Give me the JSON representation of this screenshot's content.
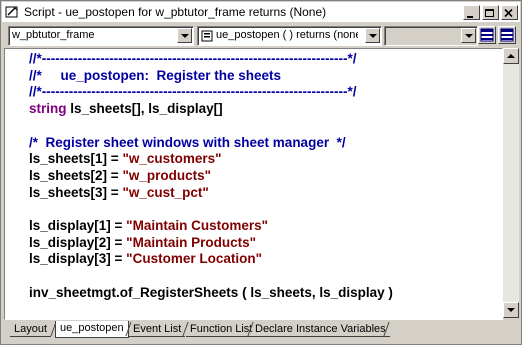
{
  "window": {
    "title": "Script - ue_postopen for w_pbtutor_frame returns (None)"
  },
  "toolbar": {
    "object_combo": "w_pbtutor_frame",
    "event_combo": "ue_postopen ( ) returns (none",
    "third_combo": ""
  },
  "code_lines": [
    [
      {
        "t": "//*--------------------------------------------------------------------*/",
        "c": "cm"
      }
    ],
    [
      {
        "t": "//*     ue_postopen:  Register the sheets",
        "c": "cm"
      }
    ],
    [
      {
        "t": "//*--------------------------------------------------------------------*/",
        "c": "cm"
      }
    ],
    [
      {
        "t": "string",
        "c": "kw"
      },
      {
        "t": " ls_sheets[], ls_display[]",
        "c": "tx"
      }
    ],
    [
      {
        "t": "",
        "c": "tx"
      }
    ],
    [
      {
        "t": "/*  Register sheet windows with sheet manager  */",
        "c": "cm"
      }
    ],
    [
      {
        "t": "ls_sheets[1] = ",
        "c": "tx"
      },
      {
        "t": "\"w_customers\"",
        "c": "st"
      }
    ],
    [
      {
        "t": "ls_sheets[2] = ",
        "c": "tx"
      },
      {
        "t": "\"w_products\"",
        "c": "st"
      }
    ],
    [
      {
        "t": "ls_sheets[3] = ",
        "c": "tx"
      },
      {
        "t": "\"w_cust_pct\"",
        "c": "st"
      }
    ],
    [
      {
        "t": "",
        "c": "tx"
      }
    ],
    [
      {
        "t": "ls_display[1] = ",
        "c": "tx"
      },
      {
        "t": "\"Maintain Customers\"",
        "c": "st"
      }
    ],
    [
      {
        "t": "ls_display[2] = ",
        "c": "tx"
      },
      {
        "t": "\"Maintain Products\"",
        "c": "st"
      }
    ],
    [
      {
        "t": "ls_display[3] = ",
        "c": "tx"
      },
      {
        "t": "\"Customer Location\"",
        "c": "st"
      }
    ],
    [
      {
        "t": "",
        "c": "tx"
      }
    ],
    [
      {
        "t": "inv_sheetmgt.of_RegisterSheets ( ls_sheets, ls_display )",
        "c": "tx"
      }
    ]
  ],
  "tabs": [
    {
      "label": "Layout",
      "active": false
    },
    {
      "label": "ue_postopen",
      "active": true
    },
    {
      "label": "Event List",
      "active": false
    },
    {
      "label": "Function List",
      "active": false
    },
    {
      "label": "Declare Instance Variables",
      "active": false
    }
  ],
  "colors": {
    "comment": "#0000a0",
    "keyword": "#800080",
    "string": "#800000",
    "text": "#000000"
  }
}
